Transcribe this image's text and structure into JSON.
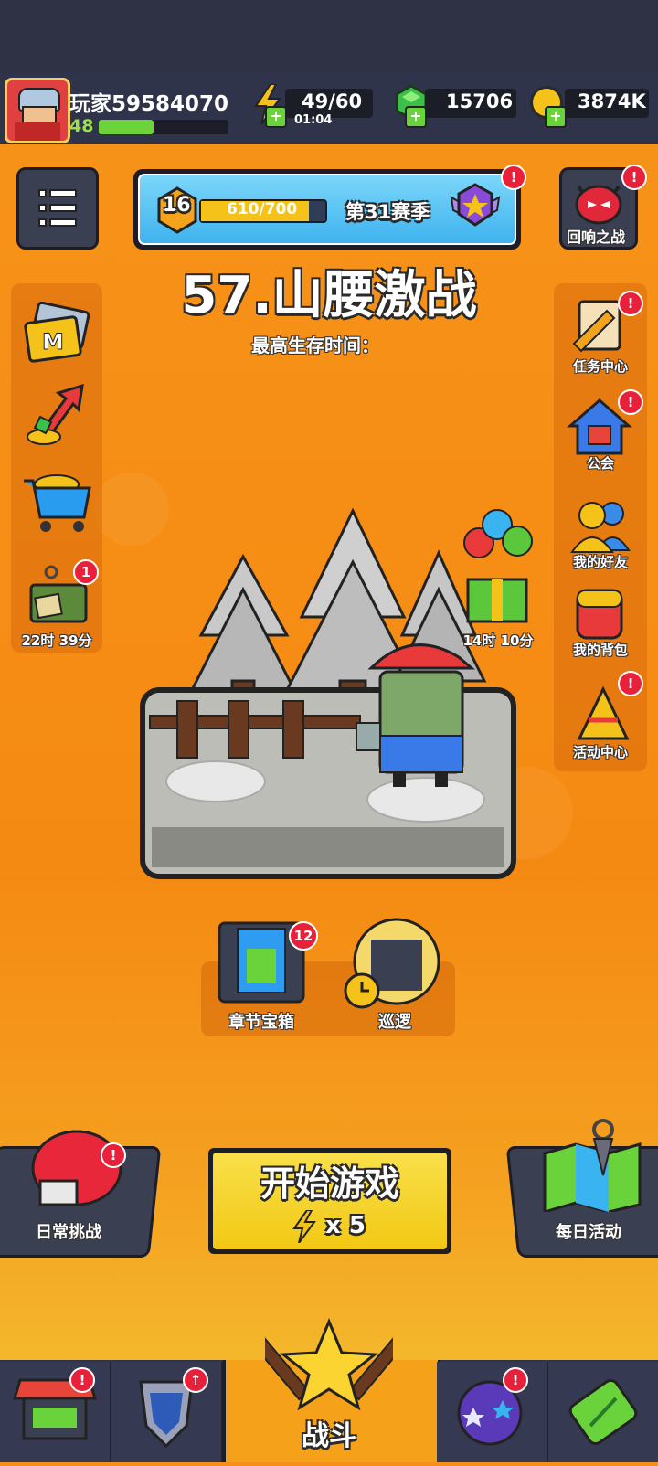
{
  "player": {
    "name": "玩家59584070",
    "level": "48"
  },
  "resources": {
    "energy": "49/60",
    "energy_timer": "01:04",
    "gems": "15706",
    "coins": "3874K"
  },
  "season": {
    "rank": "16",
    "progress": "610/700",
    "progress_fraction": 0.87,
    "label": "第31赛季"
  },
  "stage": {
    "title": "57.山腰激战",
    "subtitle": "最高生存时间："
  },
  "right_menu": {
    "echo_battle": "回响之战",
    "tasks": "任务中心",
    "guild": "公会",
    "friends": "我的好友",
    "backpack": "我的背包",
    "events": "活动中心"
  },
  "left_menu": {
    "chest_timer": "22时 39分",
    "chest_badge": "1"
  },
  "gift_timer": "14时 10分",
  "chapter_chest": {
    "label": "章节宝箱",
    "badge": "12"
  },
  "patrol": {
    "label": "巡逻"
  },
  "daily_challenge": "日常挑战",
  "daily_event": "每日活动",
  "start_button": {
    "label": "开始游戏",
    "cost": "x 5"
  },
  "nav": {
    "battle": "战斗"
  },
  "badge_mark": "!",
  "colors": {
    "accent": "#f6901a",
    "start": "#f5d31e",
    "badge": "#e8203a",
    "season_bar": "#5cc8f5"
  }
}
